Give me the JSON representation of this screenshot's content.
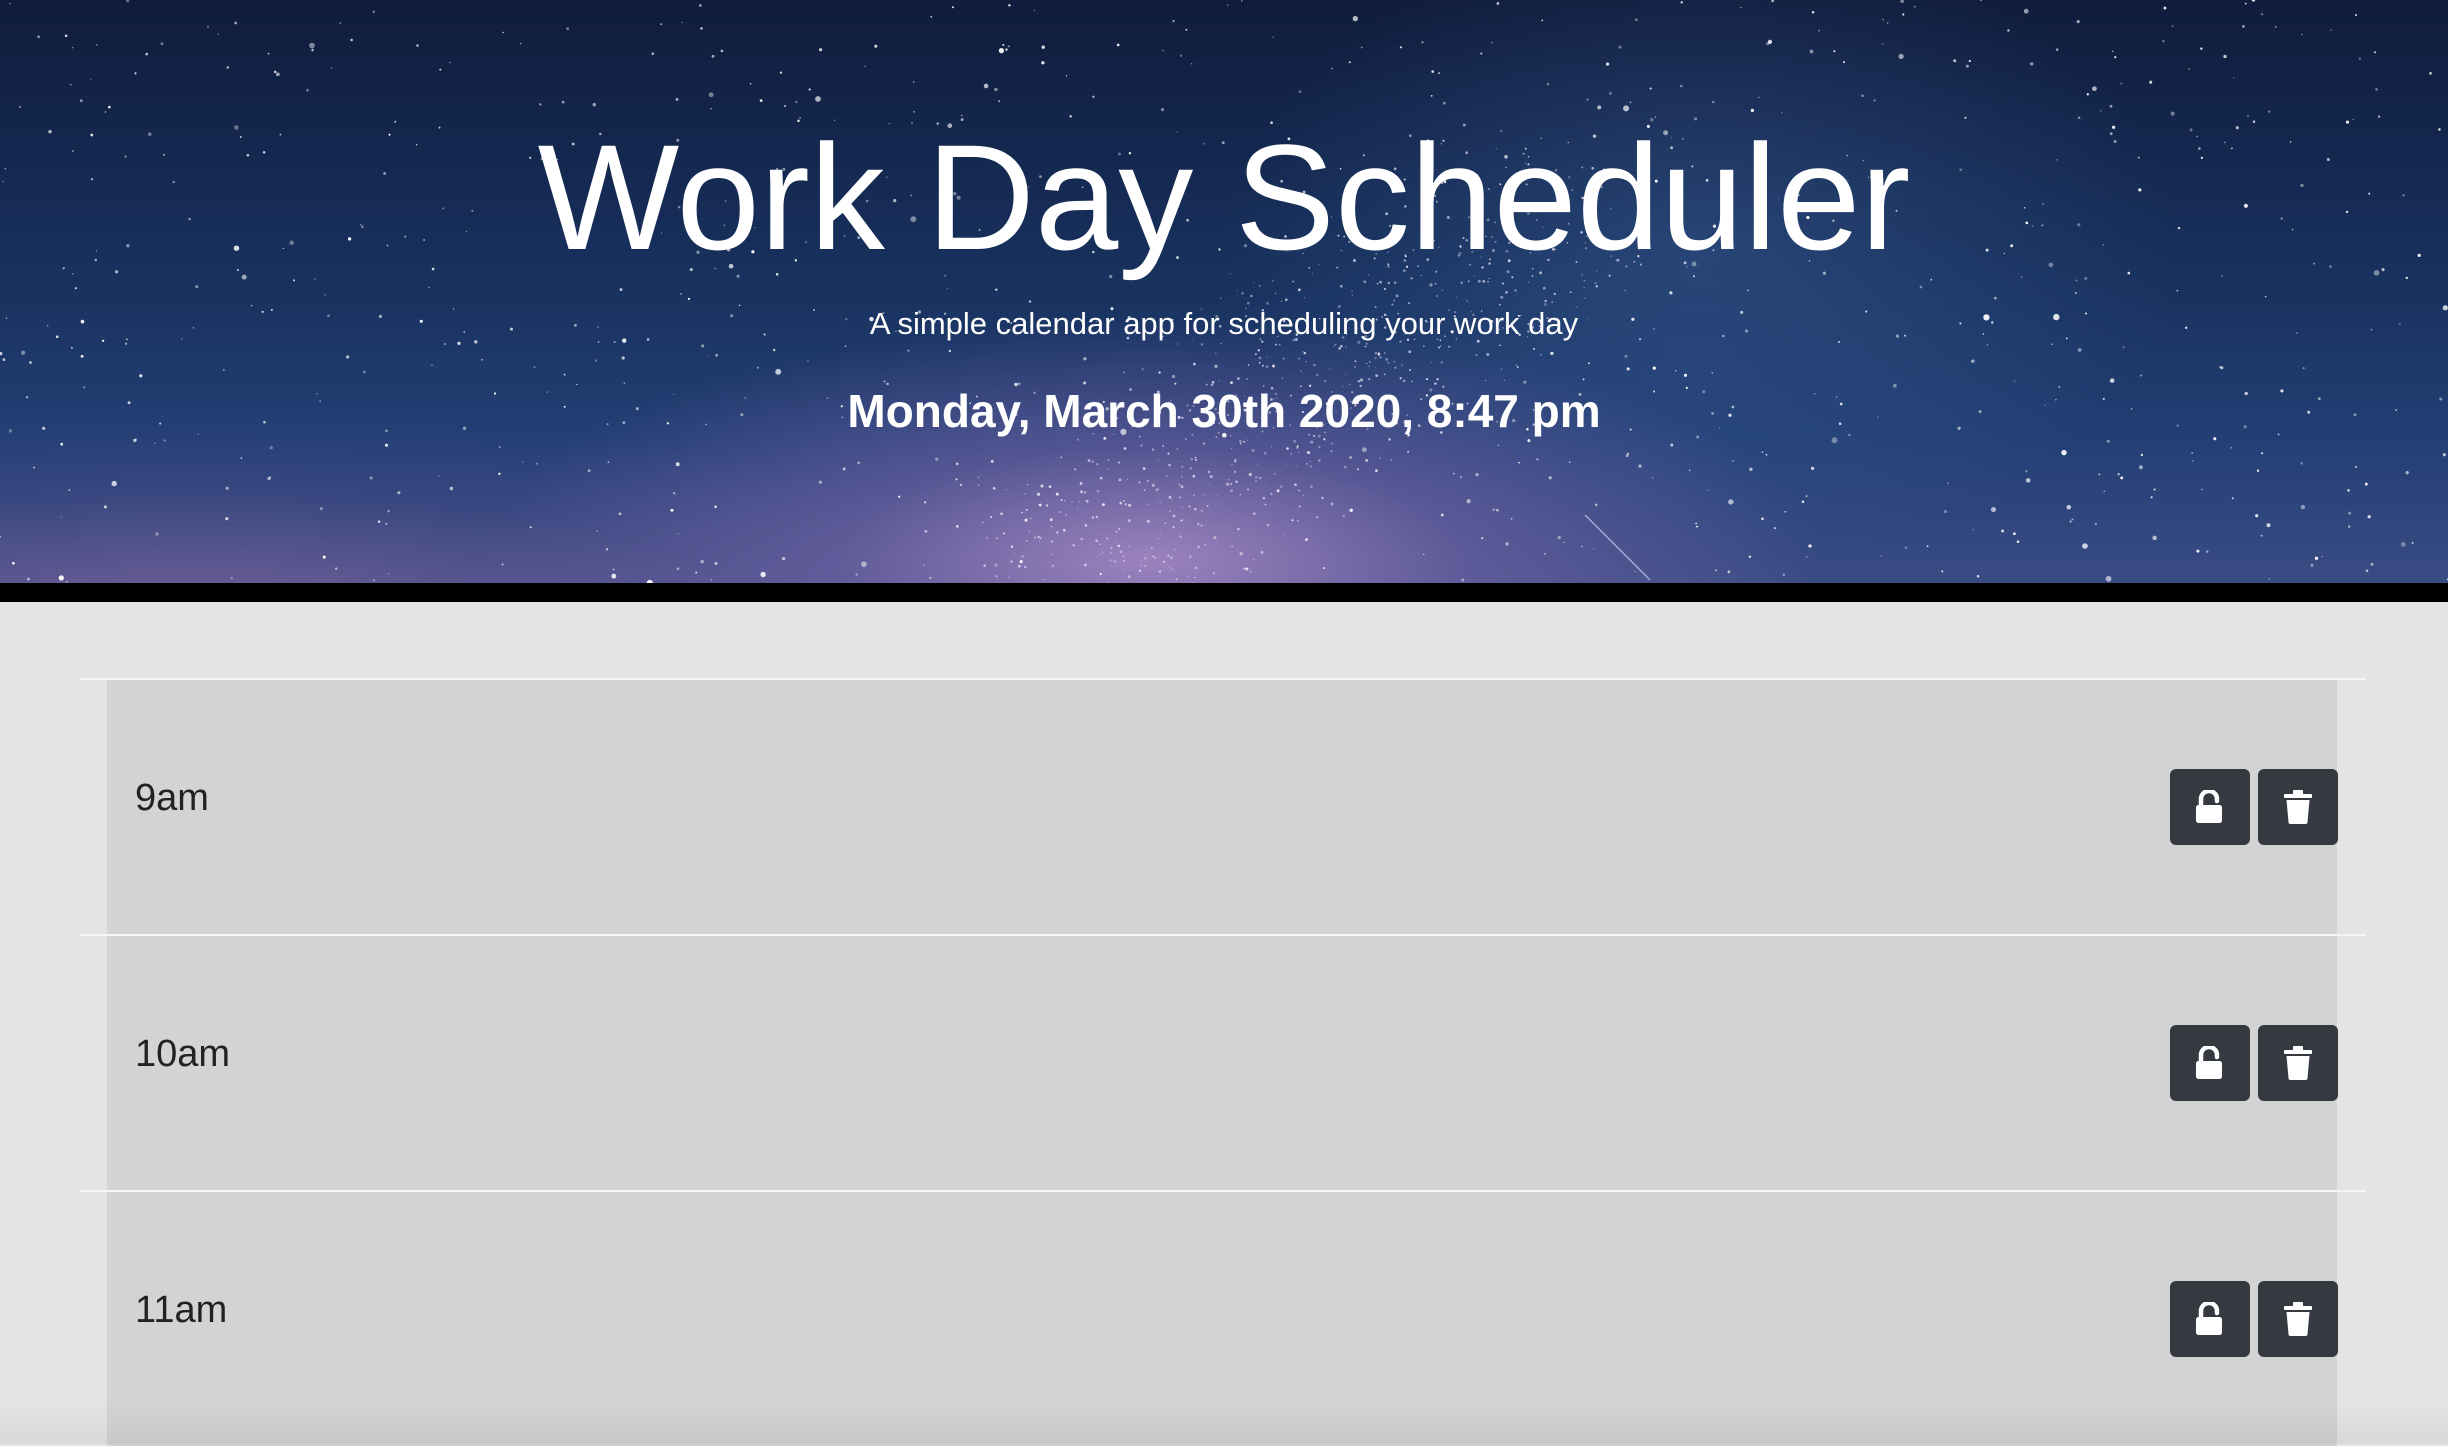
{
  "header": {
    "title": "Work Day Scheduler",
    "subtitle": "A simple calendar app for scheduling your work day",
    "current_datetime": "Monday, March 30th 2020, 8:47 pm"
  },
  "schedule": {
    "rows": [
      {
        "hour": "9am",
        "lock_icon": "unlock-icon",
        "delete_icon": "trash-icon"
      },
      {
        "hour": "10am",
        "lock_icon": "unlock-icon",
        "delete_icon": "trash-icon"
      },
      {
        "hour": "11am",
        "lock_icon": "unlock-icon",
        "delete_icon": "trash-icon"
      }
    ]
  },
  "colors": {
    "row_background": "#d3d3d3",
    "page_background": "#e4e4e4",
    "button_background": "#343a40",
    "header_text": "#ffffff"
  }
}
